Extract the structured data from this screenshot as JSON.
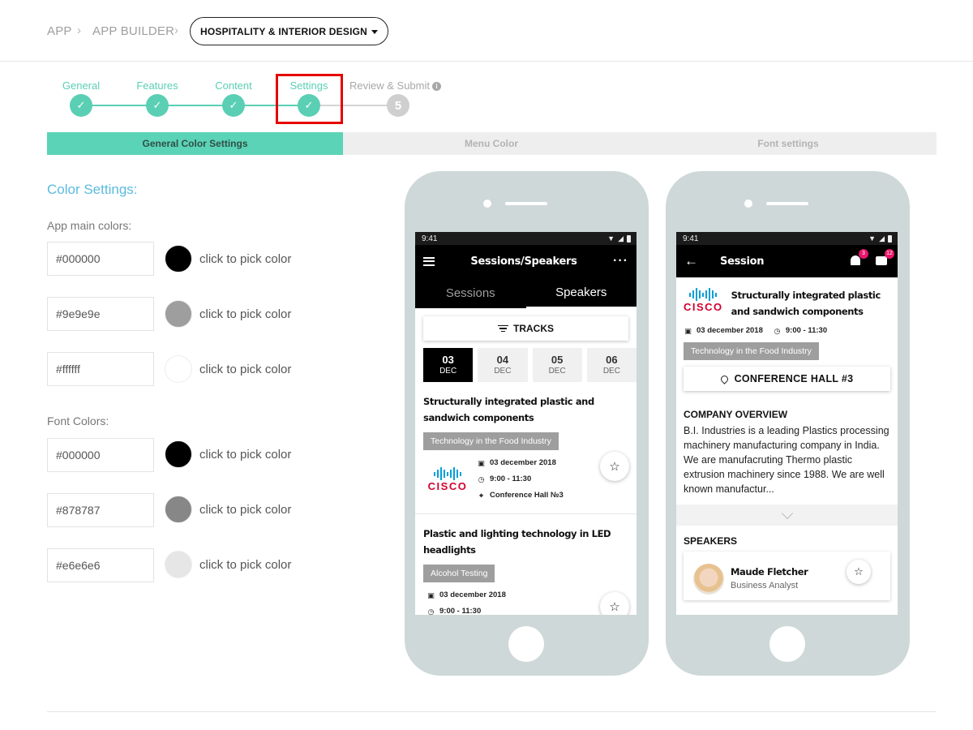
{
  "breadcrumb": {
    "app": "APP",
    "app_builder": "APP BUILDER",
    "project": "HOSPITALITY & INTERIOR DESIGN"
  },
  "stepper": {
    "steps": [
      {
        "label": "General",
        "state": "done",
        "mark": "✓"
      },
      {
        "label": "Features",
        "state": "done",
        "mark": "✓"
      },
      {
        "label": "Content",
        "state": "done",
        "mark": "✓"
      },
      {
        "label": "Settings",
        "state": "current",
        "mark": "✓"
      },
      {
        "label": "Review & Submit",
        "state": "pending",
        "mark": "5"
      }
    ]
  },
  "tabs": {
    "general": "General Color Settings",
    "menu": "Menu Color",
    "font": "Font settings"
  },
  "colors": {
    "title": "Color Settings:",
    "app_main_label": "App main colors:",
    "font_label": "Font Colors:",
    "pick_text": "click to pick color",
    "app_main": [
      "#000000",
      "#9e9e9e",
      "#ffffff"
    ],
    "font": [
      "#000000",
      "#878787",
      "#e6e6e6"
    ],
    "accent": "#5bcfb4"
  },
  "phone1": {
    "time": "9:41",
    "title": "Sessions/Speakers",
    "tab_sessions": "Sessions",
    "tab_speakers": "Speakers",
    "tracks": "TRACKS",
    "dates": [
      {
        "day": "03",
        "month": "DEC"
      },
      {
        "day": "04",
        "month": "DEC"
      },
      {
        "day": "05",
        "month": "DEC"
      },
      {
        "day": "06",
        "month": "DEC"
      }
    ],
    "sessions": [
      {
        "title": "Structurally integrated plastic and sandwich components",
        "tag": "Technology in the Food Industry",
        "date": "03 december 2018",
        "time": "9:00 - 11:30",
        "place": "Conference Hall №3",
        "logo": "cisco"
      },
      {
        "title": "Plastic and lighting technology in LED headlights",
        "tag": "Alcohol Testing",
        "date": "03 december 2018",
        "time": "9:00 - 11:30"
      }
    ]
  },
  "phone2": {
    "time": "9:41",
    "title": "Session",
    "bell_count": "3",
    "chat_count": "12",
    "session_title": "Structurally integrated plastic and sandwich components",
    "date": "03 december 2018",
    "time_range": "9:00 - 11:30",
    "tag": "Technology in the Food Industry",
    "location": "CONFERENCE HALL #3",
    "overview_heading": "COMPANY OVERVIEW",
    "overview_text": "B.I. Industries is a leading Plastics processing machinery manufacturing company in India. We are manufacruting Thermo plastic extrusion machinery since 1988. We are well known manufactur...",
    "speakers_heading": "SPEAKERS",
    "speaker_name": "Maude Fletcher",
    "speaker_role": "Business Analyst"
  },
  "logo": {
    "cisco_word": "CISCO"
  }
}
